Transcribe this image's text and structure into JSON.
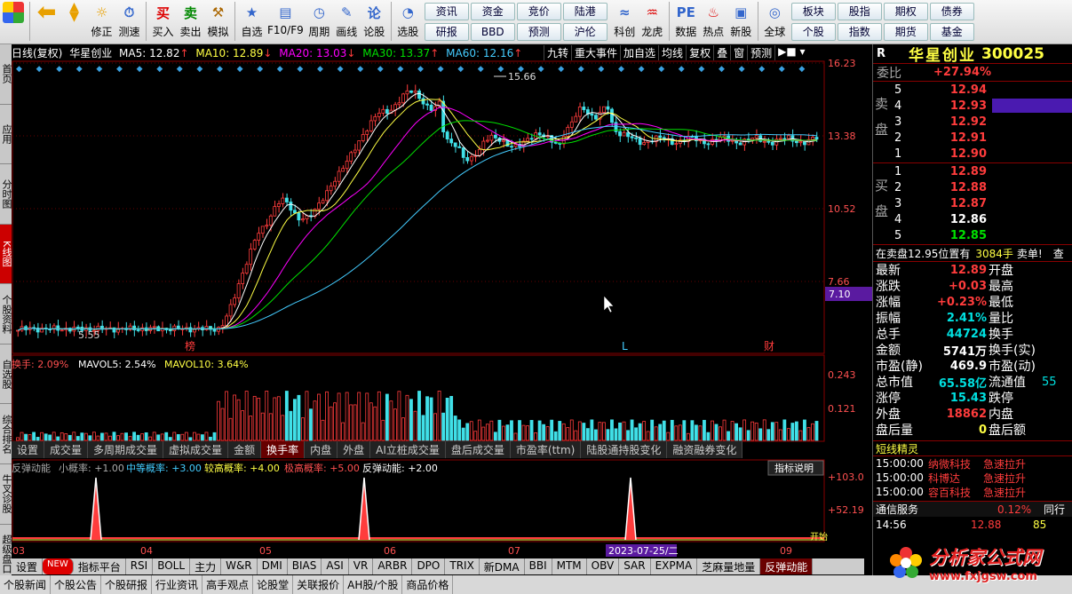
{
  "toolbar": {
    "buttons": [
      {
        "label": "修正",
        "icon": "refresh-icon"
      },
      {
        "label": "测速",
        "icon": "speed-icon"
      },
      {
        "label": "买入",
        "icon": "buy-icon"
      },
      {
        "label": "卖出",
        "icon": "sell-icon"
      },
      {
        "label": "模拟",
        "icon": "hammer-icon"
      },
      {
        "label": "自选",
        "icon": "star-icon"
      },
      {
        "label": "F10/F9",
        "icon": "f10-icon"
      },
      {
        "label": "周期",
        "icon": "clock-icon"
      },
      {
        "label": "画线",
        "icon": "pen-icon"
      },
      {
        "label": "论股",
        "icon": "discuss-icon"
      },
      {
        "label": "选股",
        "icon": "select-icon"
      }
    ],
    "menu_top": [
      "资讯",
      "资金",
      "竞价",
      "陆港"
    ],
    "menu_bottom": [
      "研报",
      "BBD",
      "预测",
      "沪伦"
    ],
    "buttons2": [
      {
        "label": "科创",
        "icon": "kc-icon"
      },
      {
        "label": "龙虎",
        "icon": "dragon-icon"
      },
      {
        "label": "数据",
        "icon": "pe-icon"
      },
      {
        "label": "热点",
        "icon": "hot-icon"
      },
      {
        "label": "新股",
        "icon": "newstock-icon"
      },
      {
        "label": "全球",
        "icon": "globe-icon"
      }
    ],
    "menu2_top": [
      "板块",
      "股指",
      "期权",
      "债券"
    ],
    "menu2_bottom": [
      "个股",
      "指数",
      "期货",
      "基金"
    ]
  },
  "left_tabs": [
    "首页",
    "应用",
    "分时图",
    "K线图",
    "个股资料",
    "自选股",
    "综合排名",
    "牛叉诊股",
    "超级盘口"
  ],
  "info_bar": {
    "period": "日线(复权)",
    "name": "华星创业",
    "ma5": "MA5: 12.82",
    "ma10": "MA10: 12.89",
    "ma20": "MA20: 13.03",
    "ma30": "MA30: 13.37",
    "ma60": "MA60: 12.16"
  },
  "chart_tabs": [
    "九转",
    "重大事件",
    "加自选",
    "均线",
    "复权",
    "叠",
    "窗",
    "预测"
  ],
  "chart_data": {
    "type": "candlestick",
    "price_axis": [
      "16.23",
      "13.38",
      "10.52",
      "7.66"
    ],
    "current_price_label": "7.10",
    "high_label": "15.66",
    "low_label": "5.55",
    "markers": [
      "榜",
      "L",
      "财"
    ],
    "x_labels": [
      "03",
      "04",
      "05",
      "06",
      "07",
      "09"
    ],
    "cursor_date": "2023-07-25/二"
  },
  "vol_panel": {
    "title": "换手: 2.09%",
    "mavol5": "MAVOL5: 2.54%",
    "mavol10": "MAVOL10: 3.64%",
    "axis": [
      "0.243",
      "0.121"
    ]
  },
  "bottom_tabs": [
    "设置",
    "成交量",
    "多周期成交量",
    "虚拟成交量",
    "金额",
    "换手率",
    "内盘",
    "外盘",
    "AI立桩成交量",
    "盘后成交量",
    "市盈率(ttm)",
    "陆股通持股变化",
    "融资融券变化"
  ],
  "ind_panel": {
    "name": "反弹动能",
    "l1": "小概率: +1.00",
    "l2": "中等概率: +3.00",
    "l3": "较高概率: +4.00",
    "l4": "极高概率: +5.00",
    "l5": "反弹动能: +2.00",
    "btn": "指标说明",
    "axis": [
      "+103.0",
      "+52.19"
    ],
    "tag": "开始"
  },
  "ind_tabs": [
    "设置",
    "NEW",
    "指标平台",
    "RSI",
    "BOLL",
    "主力",
    "W&R",
    "DMI",
    "BIAS",
    "ASI",
    "VR",
    "ARBR",
    "DPO",
    "TRIX",
    "新DMA",
    "BBI",
    "MTM",
    "OBV",
    "SAR",
    "EXPMA",
    "芝麻量地量",
    "反弹动能"
  ],
  "status_tabs": [
    "个股新闻",
    "个股公告",
    "个股研报",
    "行业资讯",
    "高手观点",
    "论股堂",
    "关联报价",
    "AH股/个股",
    "商品价格"
  ],
  "right_panel": {
    "code_label": "R",
    "name": "华星创业",
    "code": "300025",
    "weibi_label": "委比",
    "weibi": "+27.94%",
    "sell_label": "卖盘",
    "buy_label": "买盘",
    "asks": [
      {
        "lv": "5",
        "p": "12.94"
      },
      {
        "lv": "4",
        "p": "12.93"
      },
      {
        "lv": "3",
        "p": "12.92"
      },
      {
        "lv": "2",
        "p": "12.91"
      },
      {
        "lv": "1",
        "p": "12.90"
      }
    ],
    "bids": [
      {
        "lv": "1",
        "p": "12.89"
      },
      {
        "lv": "2",
        "p": "12.88"
      },
      {
        "lv": "3",
        "p": "12.87"
      },
      {
        "lv": "4",
        "p": "12.86"
      },
      {
        "lv": "5",
        "p": "12.85"
      }
    ],
    "notice": "在卖盘12.95位置有",
    "notice_vol": "3084手",
    "notice_act": "卖单!",
    "notice_tail": "查",
    "stats": [
      {
        "k": "最新",
        "v": "12.89",
        "k2": "开盘"
      },
      {
        "k": "涨跌",
        "v": "+0.03",
        "k2": "最高"
      },
      {
        "k": "涨幅",
        "v": "+0.23%",
        "k2": "最低"
      },
      {
        "k": "振幅",
        "v": "2.41%",
        "k2": "量比"
      },
      {
        "k": "总手",
        "v": "44724",
        "k2": "换手"
      },
      {
        "k": "金额",
        "v": "5741万",
        "k2": "换手(实)"
      },
      {
        "k": "市盈(静)",
        "v": "469.9",
        "k2": "市盈(动)"
      },
      {
        "k": "总市值",
        "v": "65.58亿",
        "k2": "流通值",
        "v2": "55"
      },
      {
        "k": "涨停",
        "v": "15.43",
        "k2": "跌停"
      },
      {
        "k": "外盘",
        "v": "18862",
        "k2": "内盘"
      },
      {
        "k": "盘后量",
        "v": "0",
        "k2": "盘后额"
      }
    ],
    "short_title": "短线精灵",
    "short_rows": [
      {
        "t": "15:00:00",
        "s": "纳微科技",
        "e": "急速拉升"
      },
      {
        "t": "15:00:00",
        "s": "科博达",
        "e": "急速拉升"
      },
      {
        "t": "15:00:00",
        "s": "容百科技",
        "e": "急速拉升"
      }
    ],
    "service": "通信服务",
    "service_val": "0.12%",
    "service_tail": "同行",
    "last_time": "14:56",
    "last_price": "12.88",
    "last_vol": "85"
  },
  "watermark": {
    "cn": "分析家公式网",
    "url": "www.fxjgsw.com"
  }
}
